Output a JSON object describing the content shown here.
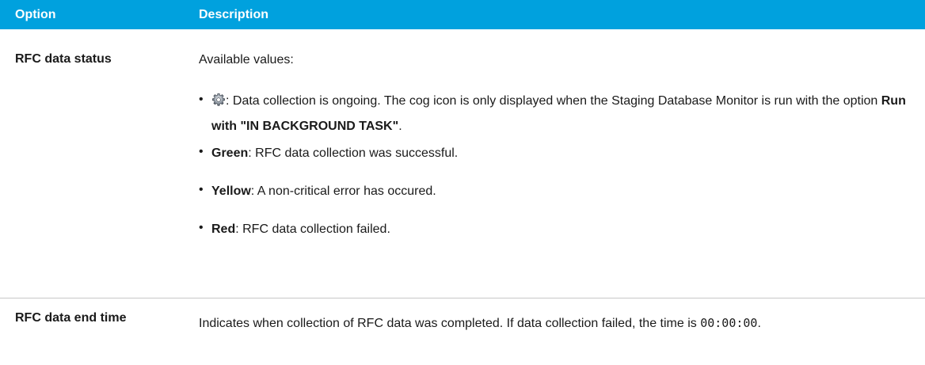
{
  "header": {
    "option_label": "Option",
    "description_label": "Description"
  },
  "rows": [
    {
      "option": "RFC data status",
      "intro": "Available values:",
      "items": [
        {
          "icon": "cog-icon",
          "text_prefix": ": Data collection is ongoing. The cog icon is only displayed when the Staging Database Monitor is run with the option ",
          "bold_suffix": "Run with \"IN BACKGROUND TASK\"",
          "end": "."
        },
        {
          "bold": "Green",
          "text": ": RFC data collection was successful."
        },
        {
          "bold": "Yellow",
          "text": ": A non-critical error has occured."
        },
        {
          "bold": "Red",
          "text": ": RFC data collection failed."
        }
      ]
    },
    {
      "option": "RFC data end time",
      "text": "Indicates when collection of RFC data was completed. If data collection failed, the time is ",
      "code": "00:00:00",
      "end": "."
    }
  ],
  "colors": {
    "header_bg": "#00a1de",
    "header_text": "#ffffff",
    "divider": "#c8c8c8"
  }
}
